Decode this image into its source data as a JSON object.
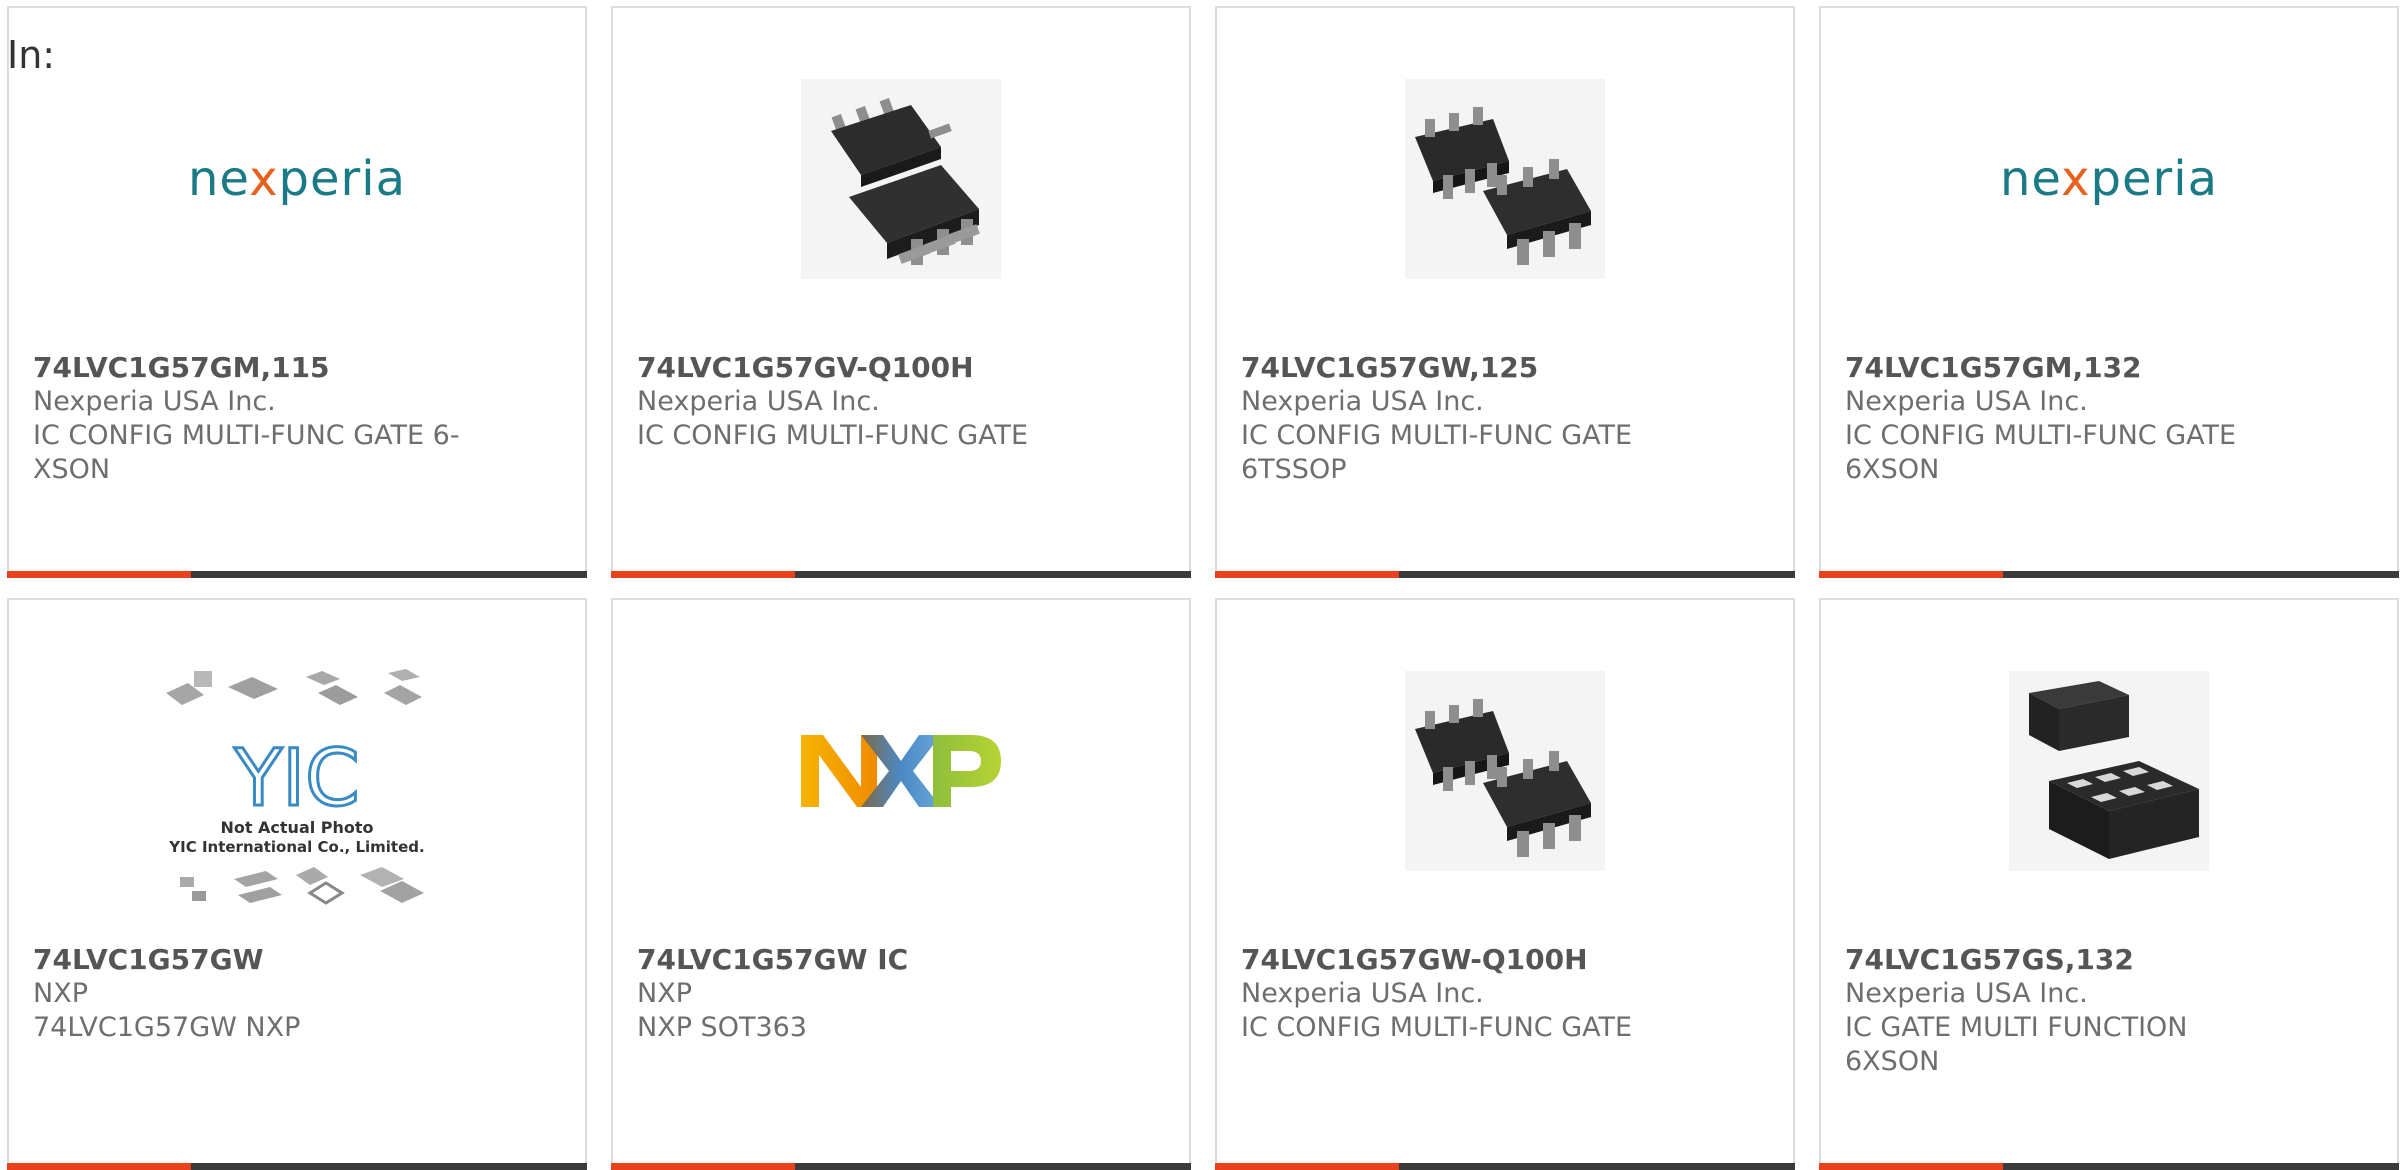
{
  "page": {
    "prefix_label": "In:"
  },
  "colors": {
    "accent": "#e8411c",
    "bar": "#3b3b3b",
    "nexperia_teal": "#1a7a86",
    "nexperia_orange": "#e8611c"
  },
  "products": [
    {
      "part_number": "74LVC1G57GM,115",
      "manufacturer": "Nexperia USA Inc.",
      "description": "IC CONFIG MULTI-FUNC GATE 6-XSON",
      "image": "nexperia-logo",
      "logo_text": {
        "pre": "ne",
        "x": "x",
        "post": "peria"
      }
    },
    {
      "part_number": "74LVC1G57GV-Q100H",
      "manufacturer": "Nexperia USA Inc.",
      "description": "IC CONFIG MULTI-FUNC GATE",
      "image": "sot23-6-chip-photo"
    },
    {
      "part_number": "74LVC1G57GW,125",
      "manufacturer": "Nexperia USA Inc.",
      "description": "IC CONFIG MULTI-FUNC GATE 6TSSOP",
      "image": "tssop6-chip-photo"
    },
    {
      "part_number": "74LVC1G57GM,132",
      "manufacturer": "Nexperia USA Inc.",
      "description": "IC CONFIG MULTI-FUNC GATE 6XSON",
      "image": "nexperia-logo",
      "logo_text": {
        "pre": "ne",
        "x": "x",
        "post": "peria"
      }
    },
    {
      "part_number": "74LVC1G57GW",
      "manufacturer": "NXP",
      "description": "74LVC1G57GW NXP",
      "image": "not-actual-photo-placeholder",
      "placeholder_text": {
        "line1": "Not Actual Photo",
        "line2": "YIC International Co., Limited.",
        "logo": "YIC"
      }
    },
    {
      "part_number": "74LVC1G57GW IC",
      "manufacturer": "NXP",
      "description": "NXP SOT363",
      "image": "nxp-logo"
    },
    {
      "part_number": "74LVC1G57GW-Q100H",
      "manufacturer": "Nexperia USA Inc.",
      "description": "IC CONFIG MULTI-FUNC GATE",
      "image": "tssop6-chip-photo"
    },
    {
      "part_number": "74LVC1G57GS,132",
      "manufacturer": "Nexperia USA Inc.",
      "description": "IC GATE MULTI FUNCTION 6XSON",
      "image": "xson6-chip-photo"
    }
  ]
}
